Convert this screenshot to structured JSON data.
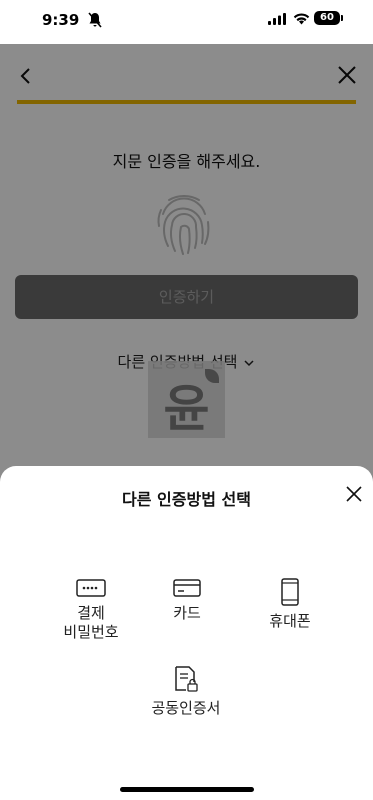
{
  "status_bar": {
    "time": "9:39",
    "battery": "60"
  },
  "page": {
    "prompt": "지문 인증을 해주세요.",
    "auth_button": "인증하기",
    "other_method_link": "다른 인증방법 선택",
    "watermark_text": "윤"
  },
  "sheet": {
    "title": "다른 인증방법 선택",
    "options": [
      {
        "line1": "결제",
        "line2": "비밀번호",
        "icon": "password-icon"
      },
      {
        "line1": "카드",
        "line2": "",
        "icon": "card-icon"
      },
      {
        "line1": "휴대폰",
        "line2": "",
        "icon": "phone-icon"
      },
      {
        "line1": "공동인증서",
        "line2": "",
        "icon": "certificate-icon"
      }
    ]
  },
  "colors": {
    "accent": "#efb900",
    "overlay": "rgba(0,0,0,0.45)"
  }
}
